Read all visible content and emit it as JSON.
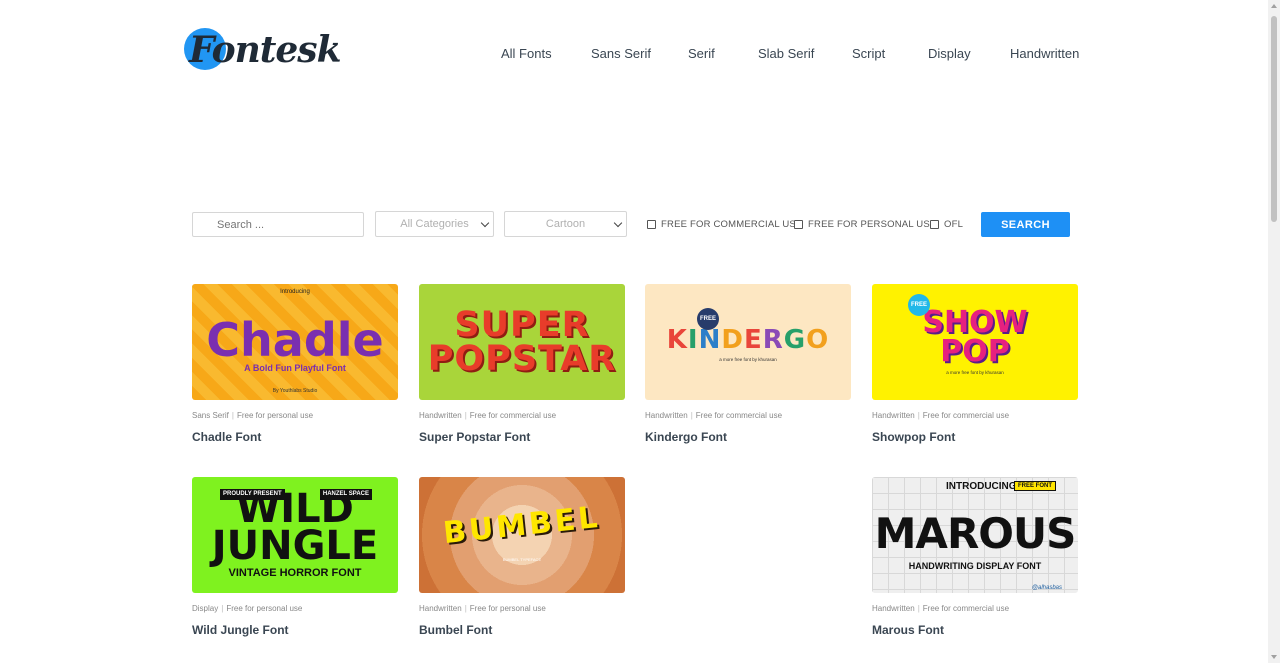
{
  "header": {
    "logo_text": "Fontesk",
    "nav": [
      "All Fonts",
      "Sans Serif",
      "Serif",
      "Slab Serif",
      "Script",
      "Display",
      "Handwritten"
    ]
  },
  "filters": {
    "search_placeholder": "Search ...",
    "category_select": "All Categories",
    "tag_select": "Cartoon",
    "check_commercial": "FREE FOR COMMERCIAL USE",
    "check_personal": "FREE FOR PERSONAL USE",
    "check_ofl": "OFL",
    "search_button": "SEARCH"
  },
  "colors": {
    "accent": "#1e90f5",
    "logo_circle": "#2196f3",
    "nav_text": "#3a4652"
  },
  "cards": [
    {
      "title": "Chadle Font",
      "category": "Sans Serif",
      "license": "Free for personal use",
      "preview": {
        "intro": "Introducing",
        "big": "Chadle",
        "sub": "A Bold Fun Playful Font",
        "by": "By Youthlabs Studio"
      }
    },
    {
      "title": "Super Popstar Font",
      "category": "Handwritten",
      "license": "Free for commercial use",
      "preview": {
        "line1": "SUPER",
        "line2": "POPSTAR"
      }
    },
    {
      "title": "Kindergo Font",
      "category": "Handwritten",
      "license": "Free for commercial use",
      "preview": {
        "badge": "FREE",
        "big": "KINDERGO",
        "sub": "a more free font by khurasan"
      }
    },
    {
      "title": "Showpop Font",
      "category": "Handwritten",
      "license": "Free for commercial use",
      "preview": {
        "badge": "FREE",
        "line1": "SHOW",
        "line2": "POP",
        "sub": "a more free font by khurasan"
      }
    },
    {
      "title": "Wild Jungle Font",
      "category": "Display",
      "license": "Free for personal use",
      "preview": {
        "tag_left": "PROUDLY PRESENT",
        "tag_right": "HANZEL SPACE",
        "line1": "WILD",
        "line2": "JUNGLE",
        "sub": "VINTAGE HORROR FONT"
      }
    },
    {
      "title": "Bumbel Font",
      "category": "Handwritten",
      "license": "Free for personal use",
      "preview": {
        "big": "BUMBEL",
        "sub": "BUMBEL TYPEFACE"
      }
    },
    {
      "title": "Marous Font",
      "category": "Handwritten",
      "license": "Free for commercial use",
      "preview": {
        "intro": "INTRODUCING",
        "badge": "FREE FONT",
        "big": "MAROUS",
        "sub": "HANDWRITING DISPLAY FONT",
        "watermark": "@alhasbas"
      }
    }
  ]
}
